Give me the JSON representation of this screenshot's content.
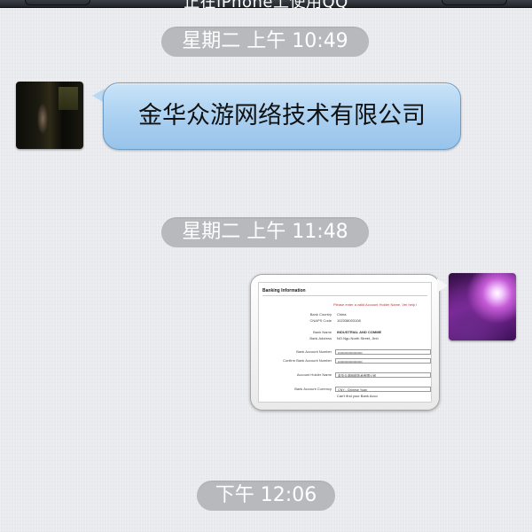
{
  "nav": {
    "title": "正在iPhone上使用QQ"
  },
  "timestamps": [
    "星期二 上午 10:49",
    "星期二 上午 11:48",
    "下午 12:06"
  ],
  "messages": [
    {
      "side": "left",
      "type": "text",
      "text": "金华众游网络技术有限公司"
    },
    {
      "side": "right",
      "type": "image"
    }
  ],
  "screenshot_image": {
    "heading": "Banking Information",
    "warning": "Please enter a valid Account Holder Name. Ver help i",
    "rows": [
      {
        "label": "Bank Country",
        "value": "China"
      },
      {
        "label": "CNAPS Code",
        "value": "102338003108"
      },
      {
        "label": "Bank Name",
        "value": "INDUSTRIAL AND COMME"
      },
      {
        "label": "Bank Address",
        "value": "NO.Ngu North Street, Jinh"
      },
      {
        "label": "Bank Account Number",
        "value": "••••••••••••••••••••••"
      },
      {
        "label": "Confirm Bank Account Number",
        "value": "••••••••••••••••••••••"
      },
      {
        "label": "Account Holder Name",
        "value": "金华众游网络技术有限公司"
      },
      {
        "label": "Bank Account Currency",
        "value": "CNY - Chinese Yuan"
      },
      {
        "label": "",
        "value": "Can't find your Bank Acco"
      }
    ]
  }
}
